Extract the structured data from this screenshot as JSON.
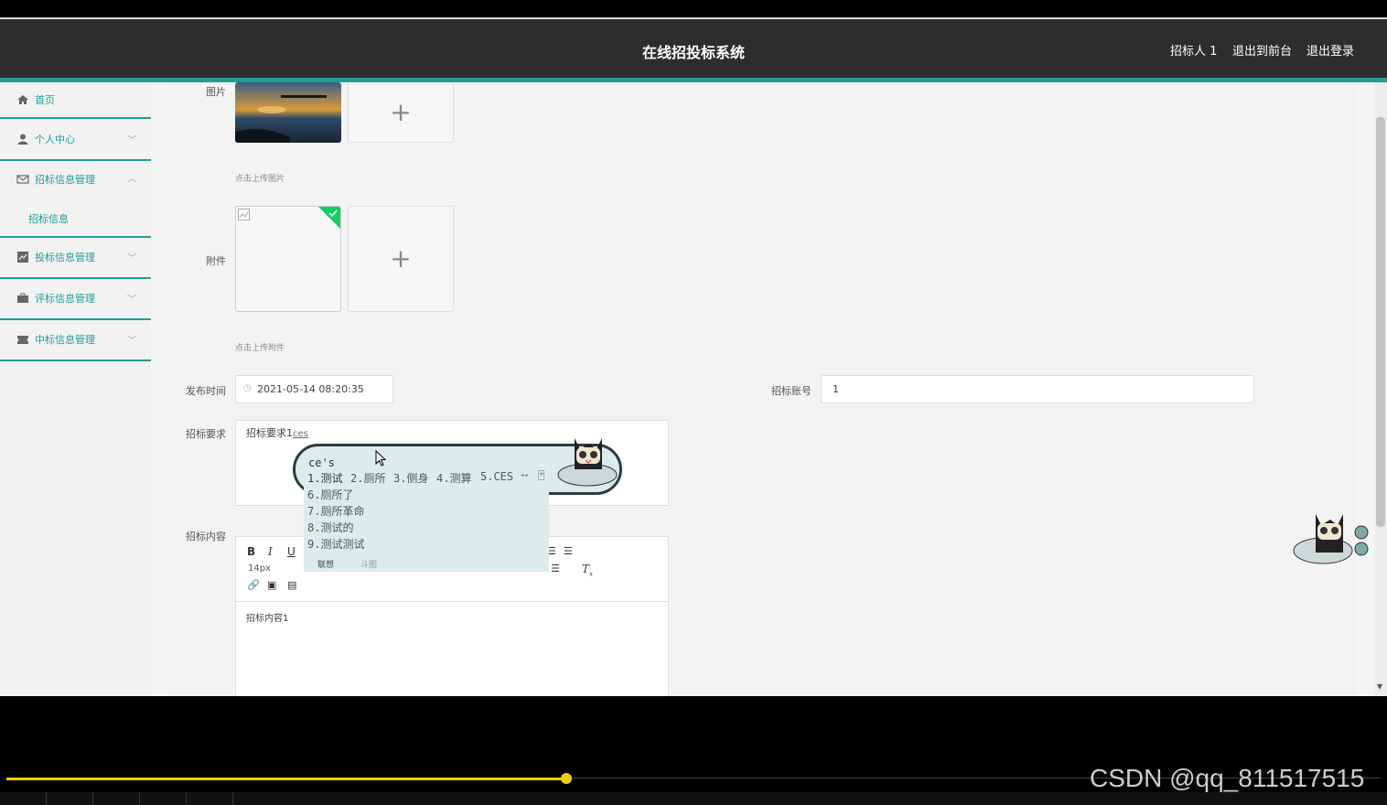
{
  "header": {
    "title": "在线招投标系统",
    "user": "招标人 1",
    "back_front": "退出到前台",
    "logout": "退出登录"
  },
  "sidebar": {
    "items": [
      {
        "label": "首页",
        "icon": "home-icon"
      },
      {
        "label": "个人中心",
        "icon": "user-icon"
      },
      {
        "label": "招标信息管理",
        "icon": "mail-icon"
      },
      {
        "label": "投标信息管理",
        "icon": "chart-icon"
      },
      {
        "label": "评标信息管理",
        "icon": "briefcase-icon"
      },
      {
        "label": "中标信息管理",
        "icon": "ticket-icon"
      }
    ],
    "sub_item": "招标信息"
  },
  "form": {
    "image_label": "图片",
    "image_hint": "点击上传图片",
    "attach_label": "附件",
    "attach_hint": "点击上传附件",
    "publish_time_label": "发布时间",
    "publish_time_value": "2021-05-14 08:20:35",
    "account_label": "招标账号",
    "account_value": "1",
    "requirement_label": "招标要求",
    "requirement_value": "招标要求1",
    "requirement_composing": "ces",
    "content_label": "招标内容",
    "content_value": "招标内容1",
    "font_size": "14px"
  },
  "ime": {
    "composition": "ce's",
    "row1": [
      "1.测试",
      "2.厕所",
      "3.侧身",
      "4.测算",
      "5.CES"
    ],
    "more": [
      "6.厕所了",
      "7.厕所革命",
      "8.测试的",
      "9.测试测试"
    ],
    "tabs": [
      "联想",
      "斗图"
    ]
  },
  "watermark": "CSDN @qq_811517515",
  "colors": {
    "accent": "#1f9d93",
    "header": "#2d2d2d",
    "progress": "#f0d000"
  }
}
